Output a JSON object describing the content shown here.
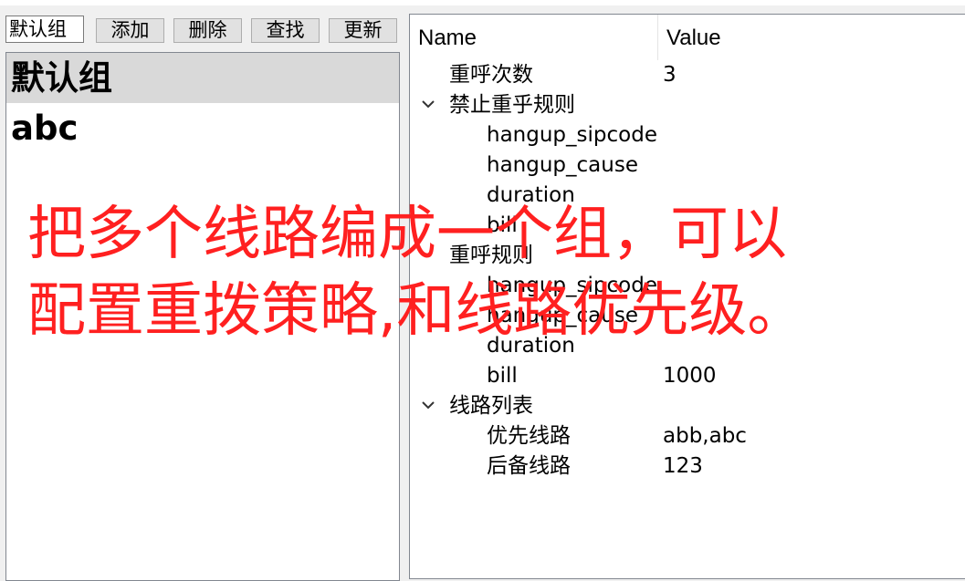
{
  "toolbar": {
    "group_input_value": "默认组",
    "add_label": "添加",
    "delete_label": "删除",
    "find_label": "查找",
    "update_label": "更新"
  },
  "groups": [
    "默认组",
    "abc"
  ],
  "tree": {
    "header_name": "Name",
    "header_value": "Value",
    "rows": [
      {
        "name": "重呼次数",
        "value": "3"
      },
      {
        "name": "禁止重乎规则",
        "value": ""
      },
      {
        "name": "hangup_sipcode",
        "value": ""
      },
      {
        "name": "hangup_cause",
        "value": ""
      },
      {
        "name": "duration",
        "value": ""
      },
      {
        "name": "bill",
        "value": ""
      },
      {
        "name": "重呼规则",
        "value": ""
      },
      {
        "name": "hangup_sipcode",
        "value": ""
      },
      {
        "name": "hangup_cause",
        "value": ""
      },
      {
        "name": "duration",
        "value": ""
      },
      {
        "name": "bill",
        "value": "1000"
      },
      {
        "name": "线路列表",
        "value": ""
      },
      {
        "name": "优先线路",
        "value": "abb,abc"
      },
      {
        "name": "后备线路",
        "value": "123"
      }
    ]
  },
  "overlay": {
    "line1": "把多个线路编成一个组，可以",
    "line2": "配置重拨策略,和线路优先级。",
    "color": "#ff2020"
  }
}
